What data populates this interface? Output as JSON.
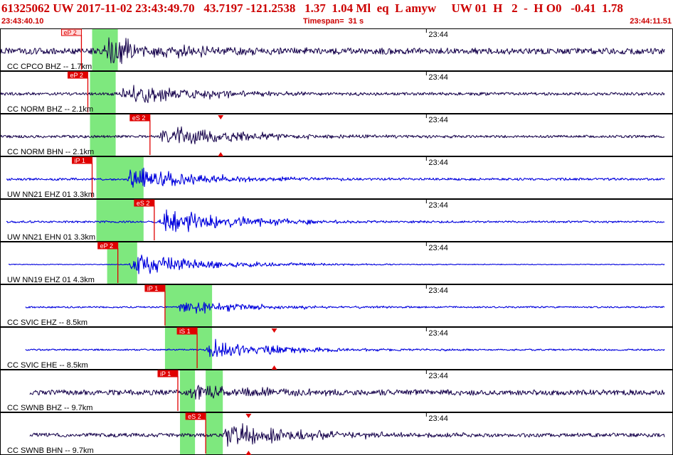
{
  "header": {
    "title": "61325062 UW 2017-11-02 23:43:49.70   43.7197 -121.2538   1.37  1.04 Ml  eq  L amyw     UW 01  H   2  -  H O0   -0.41  1.78",
    "start_time": "23:43:40.10",
    "timespan": "Timespan=  31 s",
    "end_time": "23:44:11.51"
  },
  "colors": {
    "panel_border": "#000000",
    "trace_dark": "#14004a",
    "trace_blue": "#0000dd",
    "pick_fill": "#e00000",
    "pick_outline_fill": "#ffd8d8",
    "pick_text": "#ffffff",
    "green_band": "#7ee87e",
    "time_label": "#000000"
  },
  "traces": [
    {
      "label": "CC CPCO BHZ -- 1.7km",
      "minute_label": "23:44",
      "color": "dark",
      "pick": {
        "text": "eP 2",
        "style": "outline",
        "time": 3.8
      },
      "bands": [
        [
          4.3,
          5.5
        ]
      ],
      "onset": 4.8,
      "start": 0.0,
      "end": 31.0,
      "noise": 0.16,
      "amp": 0.95
    },
    {
      "label": "CC NORM BHZ -- 2.1km",
      "minute_label": "23:44",
      "color": "dark",
      "pick": {
        "text": "eP 2",
        "style": "fill",
        "time": 4.1
      },
      "bands": [
        [
          4.2,
          5.4
        ]
      ],
      "onset": 5.6,
      "start": 0.0,
      "end": 31.0,
      "noise": 0.08,
      "amp": 0.8
    },
    {
      "label": "CC NORM BHN -- 2.1km",
      "minute_label": "23:44",
      "color": "dark",
      "pick": {
        "text": "eS 2",
        "style": "fill",
        "time": 7.0,
        "triangle": 10.3
      },
      "bands": [
        [
          4.2,
          5.4
        ]
      ],
      "onset": 7.4,
      "start": 0.0,
      "end": 31.0,
      "noise": 0.07,
      "amp": 0.85
    },
    {
      "label": "UW NN21 EHZ 01 3.3km",
      "minute_label": "23:44",
      "color": "blue",
      "pick": {
        "text": "iP 1",
        "style": "fill",
        "time": 4.3
      },
      "bands": [
        [
          4.5,
          6.7
        ]
      ],
      "onset": 5.9,
      "start": 0.3,
      "end": 31.0,
      "noise": 0.06,
      "amp": 0.75
    },
    {
      "label": "UW NN21 EHN 01 3.3km",
      "minute_label": "23:44",
      "color": "blue",
      "pick": {
        "text": "eS 2",
        "style": "fill",
        "time": 7.2
      },
      "bands": [
        [
          4.5,
          6.7
        ]
      ],
      "onset": 7.4,
      "start": 0.3,
      "end": 31.0,
      "noise": 0.05,
      "amp": 0.9
    },
    {
      "label": "UW NN19 EHZ 01 4.3km",
      "minute_label": "23:44",
      "color": "blue",
      "pick": {
        "text": "eP 2",
        "style": "fill",
        "time": 5.5
      },
      "bands": [
        [
          5.0,
          6.4
        ]
      ],
      "onset": 6.0,
      "start": 0.4,
      "end": 31.0,
      "noise": 0.02,
      "amp": 0.85
    },
    {
      "label": "CC SVIC EHZ -- 8.5km",
      "minute_label": "23:44",
      "color": "blue",
      "pick": {
        "text": "iP 1",
        "style": "fill",
        "time": 7.7
      },
      "bands": [
        [
          7.7,
          8.8
        ],
        [
          8.7,
          9.9
        ]
      ],
      "onset": 8.2,
      "start": 1.2,
      "end": 31.0,
      "noise": 0.04,
      "amp": 0.5
    },
    {
      "label": "CC SVIC EHE -- 8.5km",
      "minute_label": "23:44",
      "color": "blue",
      "pick": {
        "text": "iS 1",
        "style": "fill",
        "time": 9.2,
        "triangle": 12.8
      },
      "bands": [
        [
          7.7,
          8.8
        ],
        [
          8.7,
          9.9
        ]
      ],
      "onset": 9.5,
      "start": 1.2,
      "end": 31.0,
      "noise": 0.04,
      "amp": 0.7
    },
    {
      "label": "CC SWNB BHZ -- 9.7km",
      "minute_label": "23:44",
      "color": "dark",
      "pick": {
        "text": "iP 1",
        "style": "fill",
        "time": 8.3
      },
      "bands": [
        [
          8.4,
          9.1
        ],
        [
          9.6,
          10.4
        ]
      ],
      "onset": 8.8,
      "start": 1.4,
      "end": 31.0,
      "noise": 0.14,
      "amp": 0.55
    },
    {
      "label": "CC SWNB BHN -- 9.7km",
      "minute_label": "23:44",
      "color": "dark",
      "pick": {
        "text": "eS 2",
        "style": "fill",
        "time": 9.6,
        "triangle": 11.6
      },
      "bands": [
        [
          8.4,
          9.1
        ],
        [
          9.6,
          10.4
        ]
      ],
      "onset": 10.3,
      "start": 1.4,
      "end": 31.0,
      "noise": 0.1,
      "amp": 0.85
    }
  ]
}
